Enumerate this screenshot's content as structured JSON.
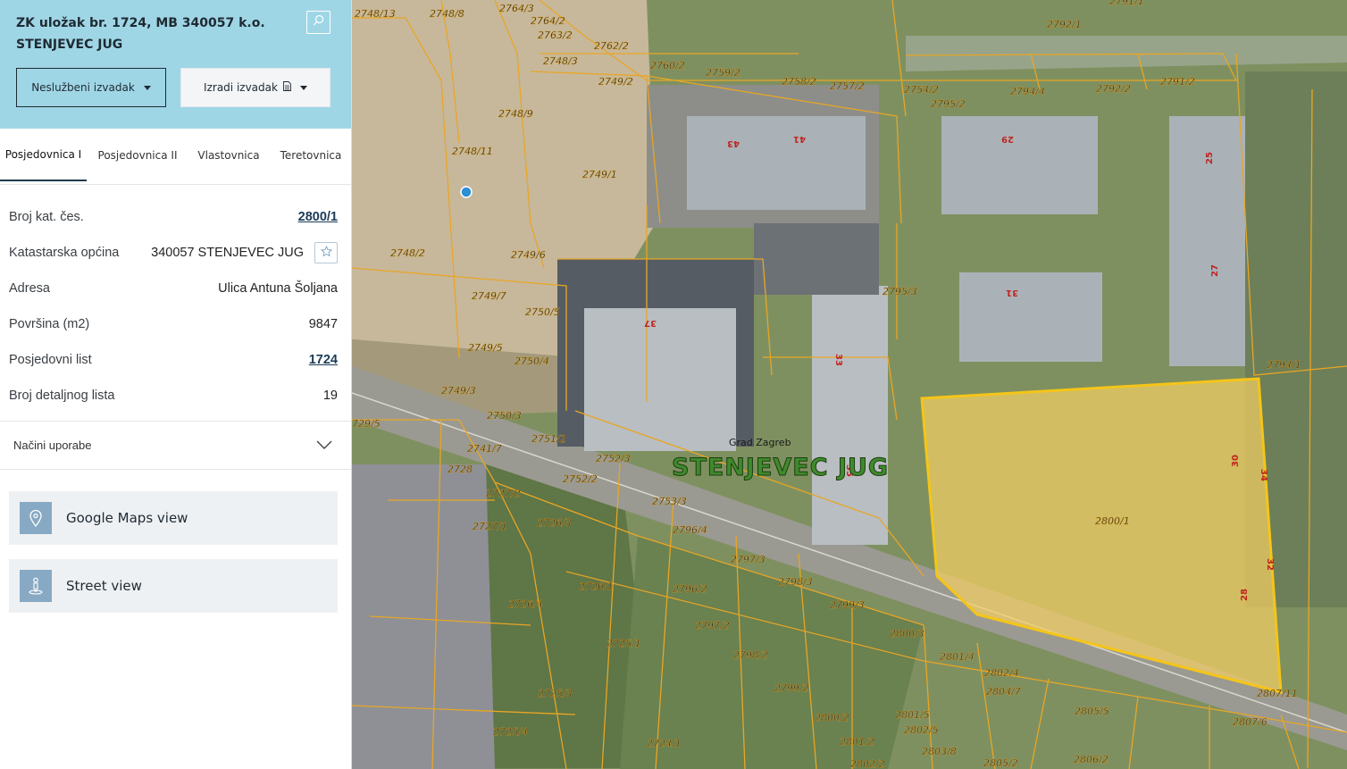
{
  "header": {
    "title": "ZK uložak br. 1724, MB 340057 k.o. STENJEVEC JUG",
    "unofficial_extract_label": "Neslužbeni izvadak",
    "create_extract_label": "Izradi izvadak"
  },
  "tabs": [
    {
      "label": "Posjedovnica I",
      "active": true
    },
    {
      "label": "Posjedovnica II",
      "active": false
    },
    {
      "label": "Vlastovnica",
      "active": false
    },
    {
      "label": "Teretovnica",
      "active": false
    }
  ],
  "info": {
    "parcel_no": {
      "label": "Broj kat. čes.",
      "value": "2800/1"
    },
    "municipality": {
      "label": "Katastarska općina",
      "value": "340057 STENJEVEC JUG"
    },
    "address": {
      "label": "Adresa",
      "value": "Ulica Antuna Šoljana"
    },
    "area": {
      "label": "Površina (m2)",
      "value": "9847"
    },
    "possession_sheet": {
      "label": "Posjedovni list",
      "value": "1724"
    },
    "detail_sheet": {
      "label": "Broj detaljnog lista",
      "value": "19"
    }
  },
  "uses": {
    "label": "Načini uporabe"
  },
  "links": {
    "google_maps": "Google Maps view",
    "street_view": "Street view"
  },
  "map": {
    "place": "Grad Zagreb",
    "district": "STENJEVEC JUG",
    "parcel_labels": [
      "2748/13",
      "2748/8",
      "2764/3",
      "2764/2",
      "2763/2",
      "2762/2",
      "2748/3",
      "2760/2",
      "2759/2",
      "2758/2",
      "2757/2",
      "2754/2",
      "2795/2",
      "2794/4",
      "2792/2",
      "2791/2",
      "2792/1",
      "2791/1",
      "2749/2",
      "2748/9",
      "2748/11",
      "2749/1",
      "2748/2",
      "2749/6",
      "2749/7",
      "2750/5",
      "2749/5",
      "2750/4",
      "2749/3",
      "2750/3",
      "729/5",
      "2741/7",
      "2751/2",
      "2752/3",
      "2728",
      "2752/2",
      "2727/2",
      "2753/3",
      "2727/1",
      "2726/3",
      "2796/4",
      "2797/3",
      "2798/3",
      "2726/1",
      "2796/2",
      "2726/4",
      "2799/3",
      "2797/2",
      "2725/1",
      "2798/2",
      "2800/3",
      "2801/4",
      "2802/4",
      "2799/2",
      "2725/3",
      "2804/7",
      "2807/11",
      "2805/5",
      "2800/2",
      "2801/5",
      "2802/5",
      "2807/6",
      "2725/4",
      "2724/1",
      "2801/2",
      "2803/8",
      "2802/2",
      "2805/2",
      "2806/2",
      "2795/3",
      "2794/1",
      "2800/1"
    ],
    "building_labels": [
      "43",
      "41",
      "29",
      "25",
      "31",
      "27",
      "37",
      "33",
      "35",
      "34",
      "30",
      "32",
      "28"
    ]
  },
  "colors": {
    "header_bg": "#9fd6e6",
    "parcel_line": "#e8a624",
    "selected_fill": "#f2cf63",
    "selected_stroke": "#f5c518",
    "accent_link": "#1b3b57"
  }
}
